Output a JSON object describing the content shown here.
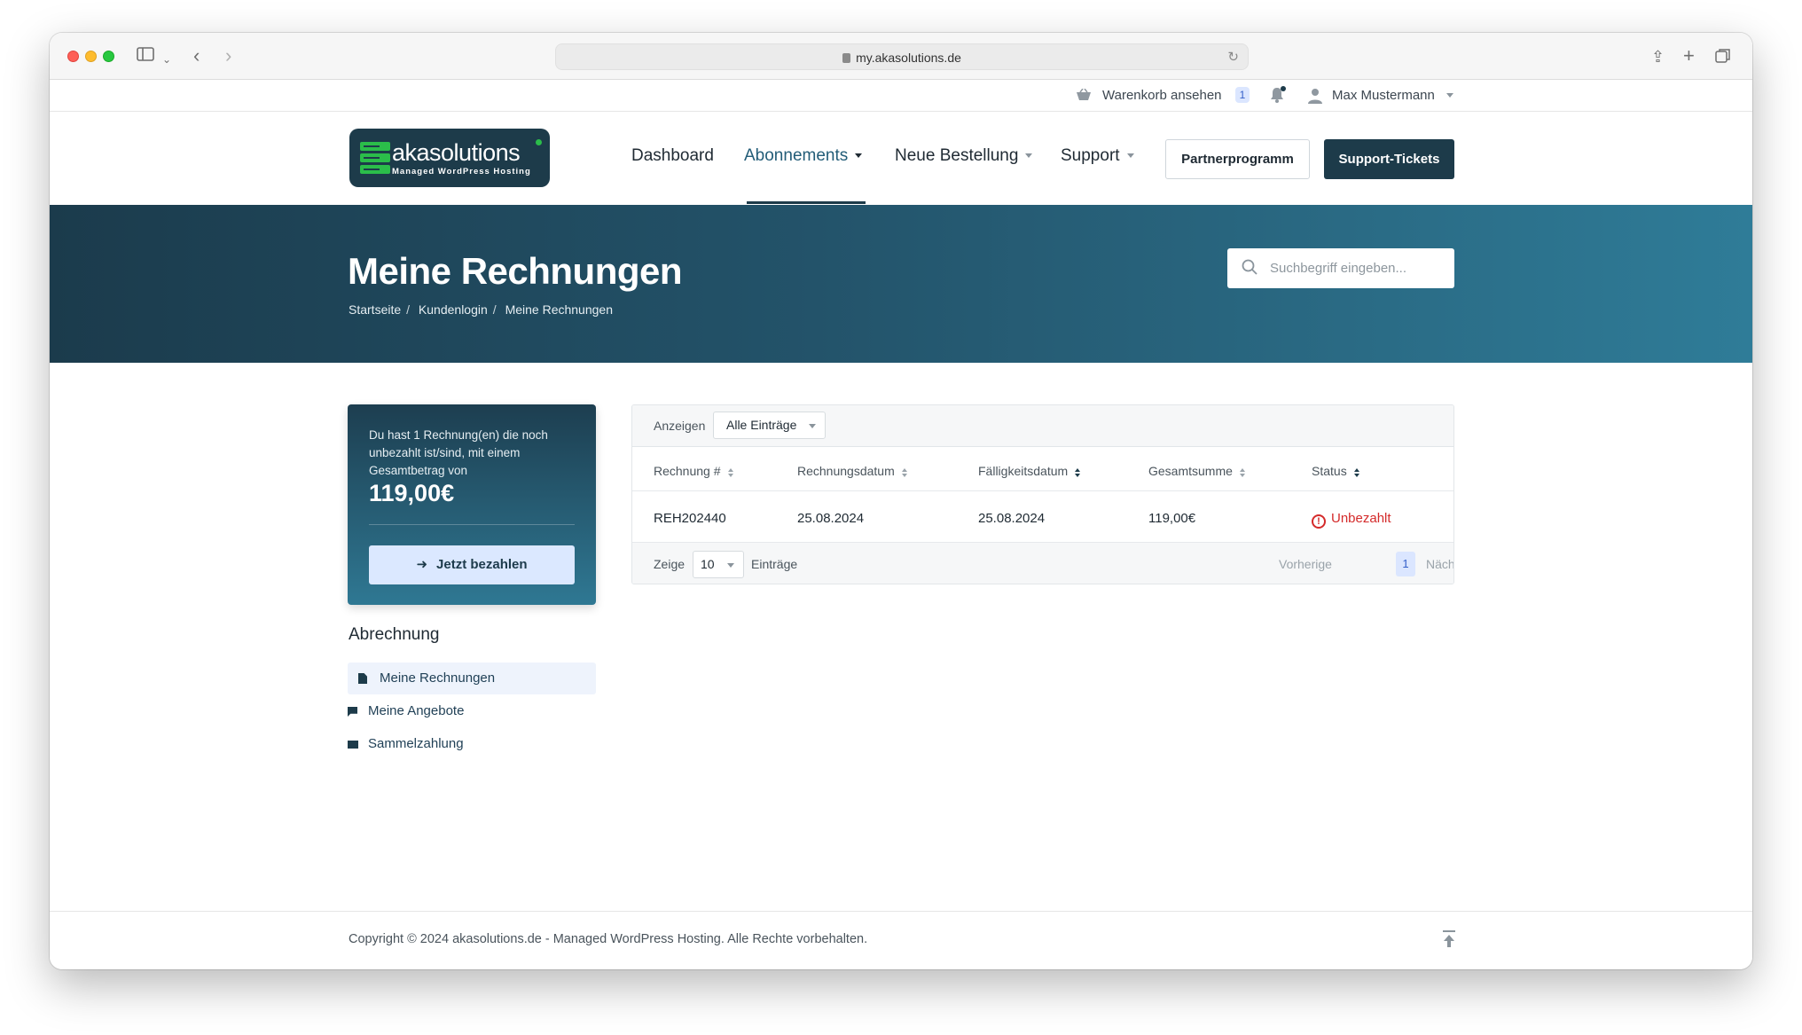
{
  "browser": {
    "url": "my.akasolutions.de"
  },
  "utilbar": {
    "cart_label": "Warenkorb ansehen",
    "cart_count": "1",
    "user_name": "Max Mustermann"
  },
  "nav": {
    "logo_name": "akasolutions",
    "logo_sub": "Managed WordPress Hosting",
    "items": [
      {
        "label": "Dashboard"
      },
      {
        "label": "Abonnements"
      },
      {
        "label": "Neue Bestellung"
      },
      {
        "label": "Support"
      }
    ],
    "partner_button": "Partnerprogramm",
    "tickets_button": "Support-Tickets"
  },
  "hero": {
    "title": "Meine Rechnungen",
    "breadcrumbs": [
      "Startseite",
      "Kundenlogin",
      "Meine Rechnungen"
    ],
    "search_placeholder": "Suchbegriff eingeben..."
  },
  "summary": {
    "text": "Du hast 1 Rechnung(en) die noch unbezahlt ist/sind, mit einem Gesamtbetrag von",
    "amount": "119,00€",
    "pay_button": "Jetzt bezahlen"
  },
  "sidebar": {
    "title": "Abrechnung",
    "items": [
      {
        "label": "Meine Rechnungen",
        "icon": "document-icon"
      },
      {
        "label": "Meine Angebote",
        "icon": "flag-icon"
      },
      {
        "label": "Sammelzahlung",
        "icon": "money-icon"
      }
    ]
  },
  "table": {
    "show_label": "Anzeigen",
    "filter_value": "Alle Einträge",
    "columns": [
      "Rechnung #",
      "Rechnungsdatum",
      "Fälligkeitsdatum",
      "Gesamtsumme",
      "Status"
    ],
    "rows": [
      {
        "number": "REH202440",
        "invoice_date": "25.08.2024",
        "due_date": "25.08.2024",
        "total": "119,00€",
        "status": "Unbezahlt"
      }
    ],
    "footer": {
      "show": "Zeige",
      "page_size": "10",
      "entries": "Einträge",
      "prev": "Vorherige",
      "page": "1",
      "next": "Nächste"
    }
  },
  "footer": {
    "copyright": "Copyright © 2024 akasolutions.de - Managed WordPress Hosting. Alle Rechte vorbehalten."
  },
  "colors": {
    "brand_dark": "#1d3b4a",
    "brand_green": "#2bbd4a",
    "status_unpaid": "#d42a2a",
    "accent_light": "#dbe6ff"
  }
}
